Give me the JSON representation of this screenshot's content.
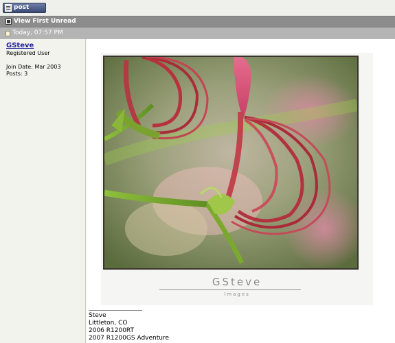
{
  "toolbar": {
    "post_reply_label": "post reply"
  },
  "thread_nav": {
    "view_first_unread_label": "View First Unread"
  },
  "post": {
    "datetime": "Today, 07:57 PM",
    "author": {
      "name": "GSteve",
      "title": "Registered User",
      "join_date": "Join Date: Mar 2003",
      "posts": "Posts: 3"
    },
    "image_watermark": {
      "title": "GSteve",
      "subtitle": "Images"
    },
    "signature": {
      "line1": "Steve",
      "line2": "Littleton, CO",
      "line3": "2006 R1200RT",
      "line4": "2007 R1200GS Adventure"
    }
  }
}
